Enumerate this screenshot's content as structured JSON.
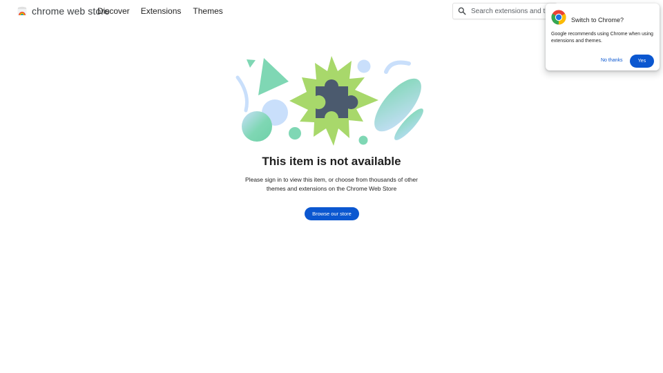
{
  "colors": {
    "accent": "#0b57d0",
    "puzzle": "#4b5a6e",
    "lime": "#a8d86b",
    "mint": "#7fd7b4",
    "light_blue": "#c9dffb"
  },
  "header": {
    "brand_icon": "chrome-web-store-logo",
    "brand_text": "chrome web store",
    "nav": [
      {
        "label": "Discover"
      },
      {
        "label": "Extensions"
      },
      {
        "label": "Themes"
      }
    ],
    "search": {
      "icon": "search-icon",
      "placeholder": "Search extensions and themes",
      "value": ""
    }
  },
  "popup": {
    "icon": "chrome-icon",
    "title": "Switch to Chrome?",
    "body": "Google recommends using Chrome when using extensions and themes.",
    "no_label": "No thanks",
    "yes_label": "Yes"
  },
  "main": {
    "illustration_icon": "puzzle-piece-illustration",
    "title": "This item is not available",
    "description": "Please sign in to view this item, or choose from thousands of other themes and extensions on the Chrome Web Store",
    "button_label": "Browse our store"
  }
}
